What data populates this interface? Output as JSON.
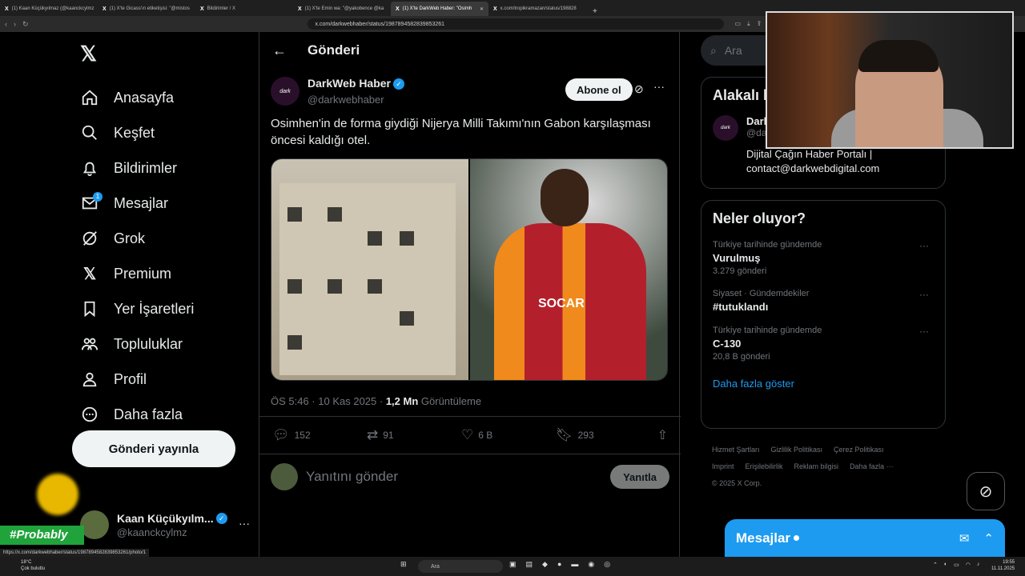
{
  "browser": {
    "tabs": [
      {
        "label": "(1) Kaan Küçükyılmaz (@kaanckcylmz"
      },
      {
        "label": "(1) X'te Gicass'ın etiketişisi: \"@mistos"
      },
      {
        "label": "Bildirimler / X"
      },
      {
        "label": "(1) X'te Emin wa: \"@yakobence @ka"
      },
      {
        "label": "(1) X'te DarkWeb Haber: \"Osimh"
      },
      {
        "label": "x.com/tropikramazan/status/198828"
      }
    ],
    "url": "x.com/darkwebhaber/status/1987894582839853261"
  },
  "sidebar": {
    "items": [
      {
        "label": "Anasayfa"
      },
      {
        "label": "Keşfet"
      },
      {
        "label": "Bildirimler"
      },
      {
        "label": "Mesajlar",
        "badge": "1"
      },
      {
        "label": "Grok"
      },
      {
        "label": "Premium"
      },
      {
        "label": "Yer İşaretleri"
      },
      {
        "label": "Topluluklar"
      },
      {
        "label": "Profil"
      },
      {
        "label": "Daha fazla"
      }
    ],
    "post_button": "Gönderi yayınla",
    "account": {
      "name": "Kaan Küçükyılm...",
      "handle": "@kaanckcylmz"
    }
  },
  "main": {
    "title": "Gönderi",
    "post": {
      "author_name": "DarkWeb Haber",
      "author_handle": "@darkwebhaber",
      "avatar_text": "dark",
      "subscribe": "Abone ol",
      "text": "Osimhen'in de forma giydiği Nijerya Milli Takımı'nın Gabon karşılaşması öncesi kaldığı otel.",
      "image_text": "SOCAR",
      "timestamp": "ÖS 5:46 · 10 Kas 2025 · ",
      "views_count": "1,2 Mn",
      "views_label": " Görüntüleme",
      "replies": "152",
      "reposts": "91",
      "likes": "6 B",
      "bookmarks": "293"
    },
    "reply": {
      "placeholder": "Yanıtını gönder",
      "button": "Yanıtla"
    }
  },
  "right": {
    "search_placeholder": "Ara",
    "related": {
      "title": "Alakalı kişiler",
      "name": "DarkWeb Haber",
      "handle": "@darkwebhaber",
      "bio": "Dijital Çağın Haber Portalı | contact@darkwebdigital.com"
    },
    "trends": {
      "title": "Neler oluyor?",
      "items": [
        {
          "category": "Türkiye tarihinde gündemde",
          "name": "Vurulmuş",
          "count": "3.279 gönderi"
        },
        {
          "category": "Siyaset · Gündemdekiler",
          "name": "#tutuklandı",
          "count": ""
        },
        {
          "category": "Türkiye tarihinde gündemde",
          "name": "C-130",
          "count": "20,8 B gönderi"
        }
      ],
      "show_more": "Daha fazla göster"
    },
    "footer": [
      "Hizmet Şartları",
      "Gizlilik Politikası",
      "Çerez Politikası",
      "Imprint",
      "Erişilebilirlik",
      "Reklam bilgisi",
      "Daha fazla ···",
      "© 2025 X Corp."
    ]
  },
  "messages": {
    "title": "Mesajlar"
  },
  "overlay": {
    "tag": "#Probably"
  },
  "status_url": "https://x.com/darkwebhaber/status/1987894582839853261/photo/1",
  "taskbar": {
    "temp": "18°C",
    "weather": "Çok bulutlu",
    "search": "Ara",
    "time": "19:55",
    "date": "11.11.2025"
  },
  "colors": {
    "accent": "#1d9bf0",
    "background": "#000000",
    "tag_green": "#1fa33a"
  }
}
